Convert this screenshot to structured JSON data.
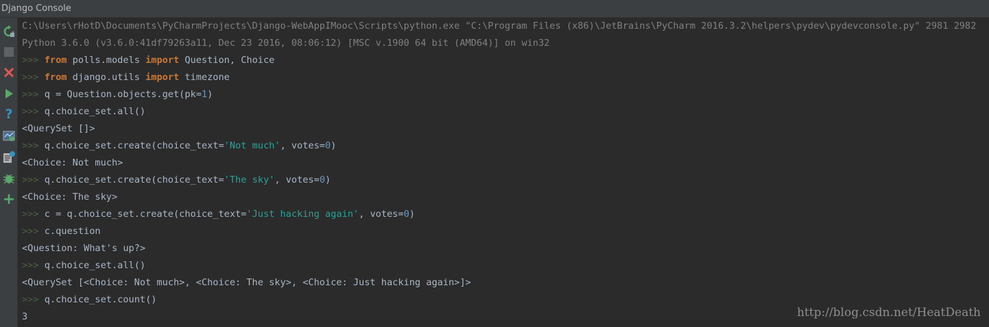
{
  "window": {
    "title": "Django Console"
  },
  "toolbar": {
    "icons": [
      "rerun-icon",
      "stop-icon",
      "close-icon",
      "run-icon",
      "help-icon",
      "show-variables-icon",
      "console-history-icon",
      "debug-icon",
      "new-console-icon"
    ]
  },
  "console": {
    "prompt": ">>>",
    "command_line": "C:\\Users\\rHotD\\Documents\\PyCharmProjects\\Django-WebAppIMooc\\Scripts\\python.exe \"C:\\Program Files (x86)\\JetBrains\\PyCharm 2016.3.2\\helpers\\pydev\\pydevconsole.py\" 2981 2982",
    "version_line": "Python 3.6.0 (v3.6.0:41df79263a11, Dec 23 2016, 08:06:12) [MSC v.1900 64 bit (AMD64)] on win32",
    "lines": [
      {
        "type": "input",
        "parts": [
          {
            "cls": "kw",
            "text": "from"
          },
          {
            "cls": "plain",
            "text": " polls.models "
          },
          {
            "cls": "kw",
            "text": "import"
          },
          {
            "cls": "plain",
            "text": " Question, Choice"
          }
        ]
      },
      {
        "type": "input",
        "parts": [
          {
            "cls": "kw",
            "text": "from"
          },
          {
            "cls": "plain",
            "text": " django.utils "
          },
          {
            "cls": "kw",
            "text": "import"
          },
          {
            "cls": "plain",
            "text": " timezone"
          }
        ]
      },
      {
        "type": "input",
        "parts": [
          {
            "cls": "plain",
            "text": "q = Question.objects.get(pk="
          },
          {
            "cls": "num",
            "text": "1"
          },
          {
            "cls": "plain",
            "text": ")"
          }
        ]
      },
      {
        "type": "input",
        "parts": [
          {
            "cls": "plain",
            "text": "q.choice_set.all()"
          }
        ]
      },
      {
        "type": "output",
        "parts": [
          {
            "cls": "plain",
            "text": "<QuerySet []>"
          }
        ]
      },
      {
        "type": "input",
        "parts": [
          {
            "cls": "plain",
            "text": "q.choice_set.create(choice_text="
          },
          {
            "cls": "str",
            "text": "'Not much'"
          },
          {
            "cls": "plain",
            "text": ", votes="
          },
          {
            "cls": "num",
            "text": "0"
          },
          {
            "cls": "plain",
            "text": ")"
          }
        ]
      },
      {
        "type": "output",
        "parts": [
          {
            "cls": "plain",
            "text": "<Choice: Not much>"
          }
        ]
      },
      {
        "type": "input",
        "parts": [
          {
            "cls": "plain",
            "text": "q.choice_set.create(choice_text="
          },
          {
            "cls": "str",
            "text": "'The sky'"
          },
          {
            "cls": "plain",
            "text": ", votes="
          },
          {
            "cls": "num",
            "text": "0"
          },
          {
            "cls": "plain",
            "text": ")"
          }
        ]
      },
      {
        "type": "output",
        "parts": [
          {
            "cls": "plain",
            "text": "<Choice: The sky>"
          }
        ]
      },
      {
        "type": "input",
        "parts": [
          {
            "cls": "plain",
            "text": "c = q.choice_set.create(choice_text="
          },
          {
            "cls": "str",
            "text": "'Just hacking again'"
          },
          {
            "cls": "plain",
            "text": ", votes="
          },
          {
            "cls": "num",
            "text": "0"
          },
          {
            "cls": "plain",
            "text": ")"
          }
        ]
      },
      {
        "type": "input",
        "parts": [
          {
            "cls": "plain",
            "text": "c.question"
          }
        ]
      },
      {
        "type": "output",
        "parts": [
          {
            "cls": "plain",
            "text": "<Question: What's up?>"
          }
        ]
      },
      {
        "type": "input",
        "parts": [
          {
            "cls": "plain",
            "text": "q.choice_set.all()"
          }
        ]
      },
      {
        "type": "output",
        "parts": [
          {
            "cls": "plain",
            "text": "<QuerySet [<Choice: Not much>, <Choice: The sky>, <Choice: Just hacking again>]>"
          }
        ]
      },
      {
        "type": "input",
        "parts": [
          {
            "cls": "plain",
            "text": "q.choice_set.count()"
          }
        ]
      },
      {
        "type": "output",
        "parts": [
          {
            "cls": "plain",
            "text": "3"
          }
        ]
      }
    ]
  },
  "watermark": "http://blog.csdn.net/HeatDeath",
  "colors": {
    "background": "#2b2b2b",
    "keyword": "#cc7832",
    "string": "#2aa198",
    "number": "#6897bb",
    "text": "#a9b7c6",
    "comment_gray": "#808080"
  }
}
